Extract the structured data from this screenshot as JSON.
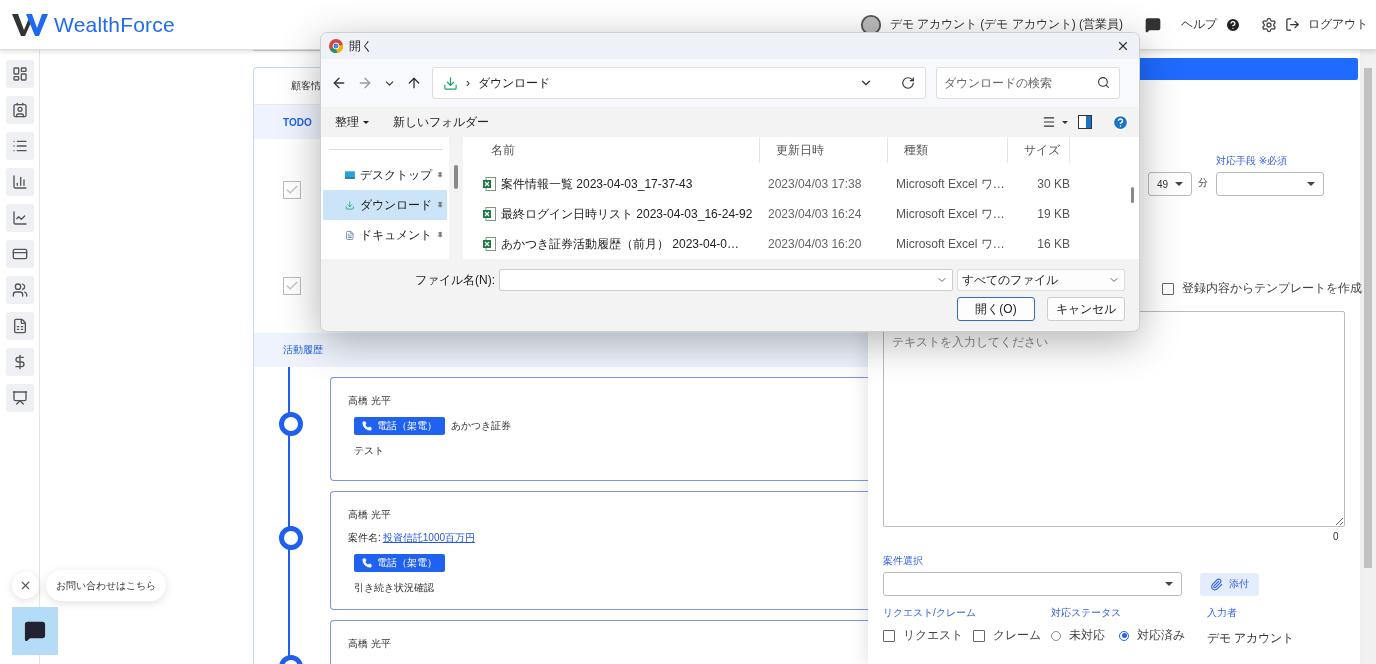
{
  "header": {
    "logo": "WealthForce",
    "user": "デモ アカウント (デモ アカウント) (営業員)",
    "help": "ヘルプ",
    "logout": "ログアウト"
  },
  "customer_card": {
    "tab": "顧客情",
    "todo_header": "TODO",
    "todos": [
      {
        "checked": true
      },
      {
        "checked": true
      }
    ],
    "history_header": "活動履歴",
    "history": [
      {
        "author": "高橋 光平",
        "channel": "電話（架電）",
        "company": "あかつき証券",
        "note": "テスト"
      },
      {
        "author": "高橋 光平",
        "case_label": "案件名:",
        "case_link": "投資信託1000百万円",
        "channel": "電話（架電）",
        "note": "引き続き状況確認"
      },
      {
        "author": "高橋 光平"
      }
    ]
  },
  "form": {
    "minute": "49",
    "minute_unit": "分",
    "method_label": "対応手段 ※必須",
    "template_checkbox": {
      "label": "登録内容からテンプレートを作成",
      "checked": false
    },
    "body": {
      "placeholder": "テキストを入力してください"
    },
    "char_count": "0",
    "case_label": "案件選択",
    "attach": "添付",
    "request_label": "リクエスト/クレーム",
    "request_options": [
      {
        "label": "リクエスト",
        "checked": false
      },
      {
        "label": "クレーム",
        "checked": false
      }
    ],
    "status_label": "対応ステータス",
    "status_options": [
      {
        "label": "未対応",
        "selected": false
      },
      {
        "label": "対応済み",
        "selected": true
      }
    ],
    "author_label": "入力者",
    "author": "デモ アカウント"
  },
  "chat": {
    "prompt": "お問い合わせはこちら"
  },
  "dialog": {
    "title": "開く",
    "path_separator": "›",
    "path": "ダウンロード",
    "search": {
      "placeholder": "ダウンロードの検索"
    },
    "toolbar": {
      "organize": "整理",
      "new_folder": "新しいフォルダー"
    },
    "nav": [
      {
        "label": "デスクトップ",
        "kind": "desktop",
        "selected": false
      },
      {
        "label": "ダウンロード",
        "kind": "download",
        "selected": true
      },
      {
        "label": "ドキュメント",
        "kind": "document",
        "selected": false
      }
    ],
    "columns": [
      "名前",
      "更新日時",
      "種類",
      "サイズ"
    ],
    "files": [
      {
        "name": "案件情報一覧 2023-04-03_17-37-43",
        "modified": "2023/04/03 17:38",
        "type": "Microsoft Excel ワ…",
        "size": "30 KB"
      },
      {
        "name": "最終ログイン日時リスト 2023-04-03_16-24-92",
        "modified": "2023/04/03 16:24",
        "type": "Microsoft Excel ワ…",
        "size": "19 KB"
      },
      {
        "name": "あかつき証券活動履歴（前月） 2023-04-0…",
        "modified": "2023/04/03 16:20",
        "type": "Microsoft Excel ワ…",
        "size": "16 KB"
      }
    ],
    "filename_label": "ファイル名(N):",
    "filter": "すべてのファイル",
    "buttons": [
      {
        "label": "開く(O)",
        "primary": true
      },
      {
        "label": "キャンセル",
        "primary": false
      }
    ]
  }
}
